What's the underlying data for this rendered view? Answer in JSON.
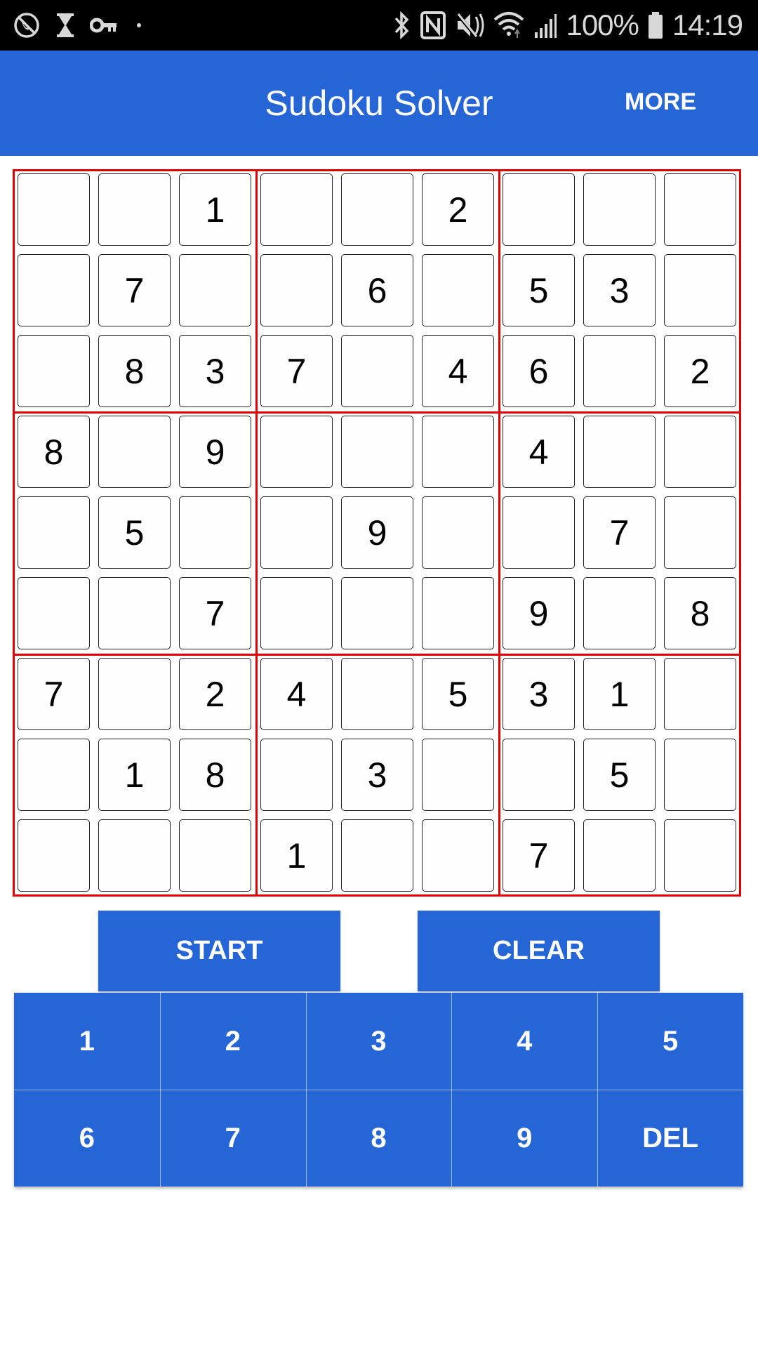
{
  "status_bar": {
    "left_icons": [
      "call-blocked-icon",
      "hourglass-icon",
      "key-icon",
      "dot-icon"
    ],
    "right_icons": [
      "bluetooth-icon",
      "nfc-icon",
      "mute-icon",
      "wifi-icon",
      "signal-icon",
      "battery-icon"
    ],
    "battery": "100%",
    "time": "14:19"
  },
  "app_bar": {
    "title": "Sudoku Solver",
    "menu_label": "MORE"
  },
  "colors": {
    "primary": "#2565d6",
    "grid_lines": "#e00000",
    "status_bar": "#000000"
  },
  "board": [
    [
      "",
      "",
      "1",
      "",
      "",
      "2",
      "",
      "",
      ""
    ],
    [
      "",
      "7",
      "",
      "",
      "6",
      "",
      "5",
      "3",
      ""
    ],
    [
      "",
      "8",
      "3",
      "7",
      "",
      "4",
      "6",
      "",
      "2"
    ],
    [
      "8",
      "",
      "9",
      "",
      "",
      "",
      "4",
      "",
      ""
    ],
    [
      "",
      "5",
      "",
      "",
      "9",
      "",
      "",
      "7",
      ""
    ],
    [
      "",
      "",
      "7",
      "",
      "",
      "",
      "9",
      "",
      "8"
    ],
    [
      "7",
      "",
      "2",
      "4",
      "",
      "5",
      "3",
      "1",
      ""
    ],
    [
      "",
      "1",
      "8",
      "",
      "3",
      "",
      "",
      "5",
      ""
    ],
    [
      "",
      "",
      "",
      "1",
      "",
      "",
      "7",
      "",
      ""
    ]
  ],
  "actions": {
    "start_label": "START",
    "clear_label": "CLEAR"
  },
  "keypad": {
    "keys": [
      "1",
      "2",
      "3",
      "4",
      "5",
      "6",
      "7",
      "8",
      "9",
      "DEL"
    ]
  }
}
